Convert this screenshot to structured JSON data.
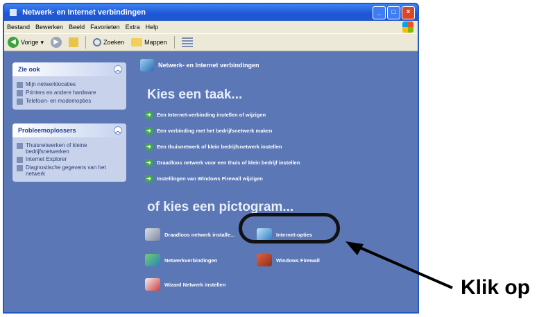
{
  "window": {
    "title": "Netwerk- en Internet verbindingen",
    "controls": [
      "_",
      "□",
      "×"
    ]
  },
  "menubar": [
    "Bestand",
    "Bewerken",
    "Beeld",
    "Favorieten",
    "Extra",
    "Help"
  ],
  "toolbar": {
    "back_label": "Vorige",
    "search_label": "Zoeken",
    "folders_label": "Mappen"
  },
  "sidebar": {
    "panel1": {
      "title": "Zie ook",
      "items": [
        "Mijn netwerklocaties",
        "Printers en andere hardware",
        "Telefoon- en modemopties"
      ]
    },
    "panel2": {
      "title": "Probleemoplossers",
      "items": [
        "Thuisnetwerken of kleine bedrijfsnetwerken",
        "Internet Explorer",
        "Diagnostische gegevens van het netwerk"
      ]
    }
  },
  "main": {
    "header": "Netwerk- en Internet verbindingen",
    "task_title": "Kies een taak...",
    "tasks": [
      "Een Internet-verbinding instellen of wijzigen",
      "Een verbinding met het bedrijfsnetwerk maken",
      "Een thuisnetwerk of klein bedrijfsnetwerk instellen",
      "Draadloos netwerk voor een thuis of klein bedrijf instellen",
      "Instellingen van Windows Firewall wijzigen"
    ],
    "icon_title": "of kies een pictogram...",
    "icons": {
      "wireless": "Draadloos netwerk installe...",
      "internet_options": "Internet-opties",
      "network_connections": "Netwerkverbindingen",
      "firewall": "Windows Firewall",
      "wizard": "Wizard Netwerk instellen"
    }
  },
  "annotation": {
    "label": "Klik op"
  }
}
